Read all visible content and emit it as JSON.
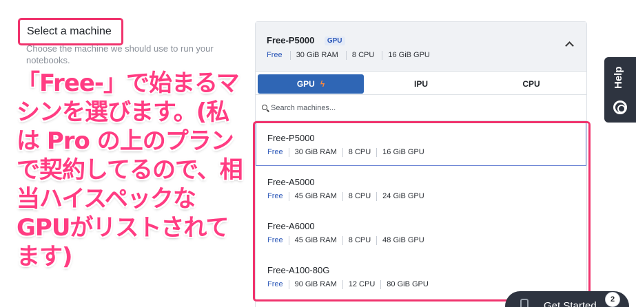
{
  "form": {
    "section_title": "Select a machine",
    "section_description": "Choose the machine we should use to run your notebooks."
  },
  "annotation": {
    "text": "「Free-」で始まるマシンを選びます。(私は Pro の上のプランで契約してるので、相当ハイスペックなGPUがリストされてます)",
    "color": "#ff3c82"
  },
  "selected_machine": {
    "name": "Free-P5000",
    "badge": "GPU",
    "tier": "Free",
    "ram": "30 GiB RAM",
    "cpu": "8 CPU",
    "gpu": "16 GiB GPU"
  },
  "tabs": [
    {
      "label": "GPU",
      "icon": "bolt-icon",
      "active": true
    },
    {
      "label": "IPU",
      "active": false
    },
    {
      "label": "CPU",
      "active": false
    }
  ],
  "search": {
    "placeholder": "Search machines..."
  },
  "machines": [
    {
      "name": "Free-P5000",
      "tier": "Free",
      "ram": "30 GiB RAM",
      "cpu": "8 CPU",
      "gpu": "16 GiB GPU"
    },
    {
      "name": "Free-A5000",
      "tier": "Free",
      "ram": "45 GiB RAM",
      "cpu": "8 CPU",
      "gpu": "24 GiB GPU"
    },
    {
      "name": "Free-A6000",
      "tier": "Free",
      "ram": "45 GiB RAM",
      "cpu": "8 CPU",
      "gpu": "48 GiB GPU"
    },
    {
      "name": "Free-A100-80G",
      "tier": "Free",
      "ram": "90 GiB RAM",
      "cpu": "12 CPU",
      "gpu": "80 GiB GPU"
    }
  ],
  "help": {
    "label": "Help",
    "icon": "lifebuoy-icon"
  },
  "get_started": {
    "label": "Get Started",
    "count": "2"
  },
  "colors": {
    "accent": "#2f66b5",
    "tier": "#2c58b8",
    "highlight": "#f0336d",
    "dark": "#2e3440"
  }
}
